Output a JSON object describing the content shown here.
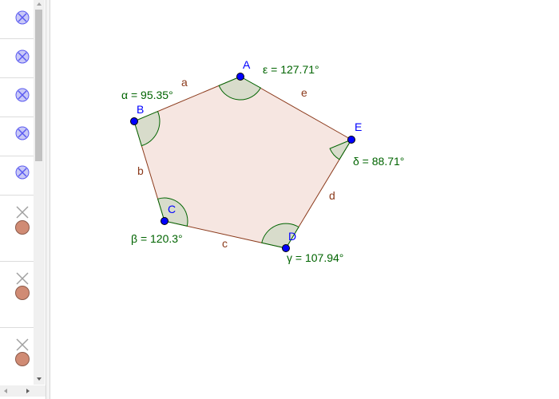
{
  "algebra": {
    "rows": [
      {
        "type": "hidden-object"
      },
      {
        "type": "hidden-object"
      },
      {
        "type": "hidden-object"
      },
      {
        "type": "hidden-object"
      },
      {
        "type": "hidden-object"
      },
      {
        "type": "visible-object"
      },
      {
        "type": "visible-object"
      },
      {
        "type": "visible-object"
      }
    ]
  },
  "colors": {
    "polygon_fill": "#f6e6e1",
    "edge": "#8b3a1b",
    "edge_label": "#8b3a1b",
    "point": "#0000ff",
    "point_label": "#0000ff",
    "angle_fill": "#d8dccb",
    "angle_label": "#006400",
    "angle_stroke": "#006400",
    "toggle_off": "#5a5af0",
    "toggle_on_fill": "#d08b74"
  },
  "points": {
    "A": {
      "label": "A"
    },
    "B": {
      "label": "B"
    },
    "C": {
      "label": "C"
    },
    "D": {
      "label": "D"
    },
    "E": {
      "label": "E"
    }
  },
  "edges": {
    "a": "a",
    "b": "b",
    "c": "c",
    "d": "d",
    "e": "e"
  },
  "angles": {
    "alpha": "α = 95.35°",
    "beta": "β = 120.3°",
    "gamma": "γ = 107.94°",
    "delta": "δ = 88.71°",
    "epsilon": "ε = 127.71°"
  }
}
